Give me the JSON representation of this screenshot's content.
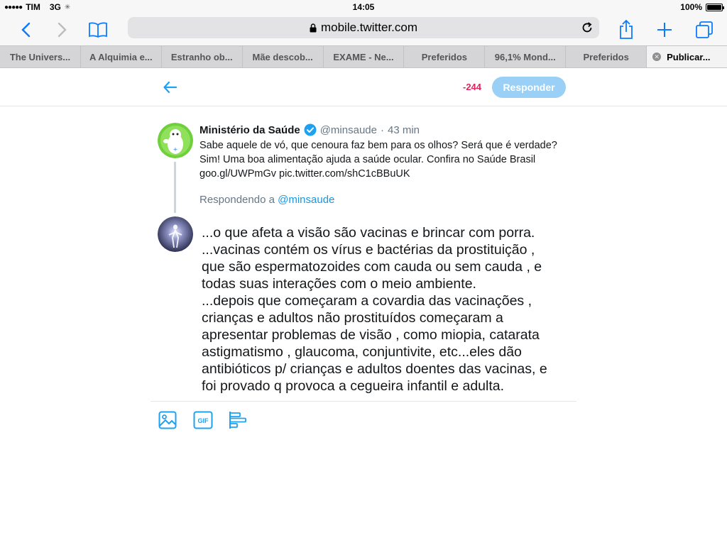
{
  "status_bar": {
    "carrier": "TIM",
    "network": "3G",
    "time": "14:05",
    "battery": "100%",
    "battery_level": 1.0
  },
  "browser": {
    "url": "mobile.twitter.com",
    "tabs": [
      {
        "label": "The Univers..."
      },
      {
        "label": "A Alquimia e..."
      },
      {
        "label": "Estranho ob..."
      },
      {
        "label": "Mãe descob..."
      },
      {
        "label": "EXAME - Ne..."
      },
      {
        "label": "Preferidos"
      },
      {
        "label": "96,1% Mond..."
      },
      {
        "label": "Preferidos"
      },
      {
        "label": "Publicar..."
      }
    ]
  },
  "compose": {
    "char_count": "-244",
    "reply_button": "Responder"
  },
  "original_tweet": {
    "name": "Ministério da Saúde",
    "handle": "@minsaude",
    "separator": "·",
    "time": "43 min",
    "text": "Sabe aquele de vó, que cenoura faz bem para os olhos? Será que é verdade? Sim! Uma boa alimentação ajuda a saúde ocular. Confira no Saúde Brasil goo.gl/UWPmGv pic.twitter.com/shC1cBBuUK",
    "replying_prefix": "Respondendo a",
    "replying_handle": "@minsaude"
  },
  "reply": {
    "text": "...o que afeta a visão são vacinas e brincar com porra.\n...vacinas contém os vírus e bactérias da prostituição ,\n que são espermatozoides com cauda ou sem cauda , e\n todas suas interações com o meio ambiente.\n...depois que começaram a covardia das vacinações ,\n crianças e adultos não prostituídos começaram a\n apresentar problemas de visão , como miopia, catarata\n astigmatismo , glaucoma, conjuntivite, etc...eles dão\n antibióticos p/ crianças e adultos doentes das vacinas, e\n foi provado q provoca a cegueira infantil e adulta."
  },
  "tools": [
    {
      "icon": "image-icon"
    },
    {
      "icon": "gif-icon",
      "label": "GIF"
    },
    {
      "icon": "poll-icon"
    }
  ],
  "colors": {
    "twitter_blue": "#1da1f2",
    "reply_disabled": "#9ad0f5",
    "counter_red": "#e0245e"
  }
}
